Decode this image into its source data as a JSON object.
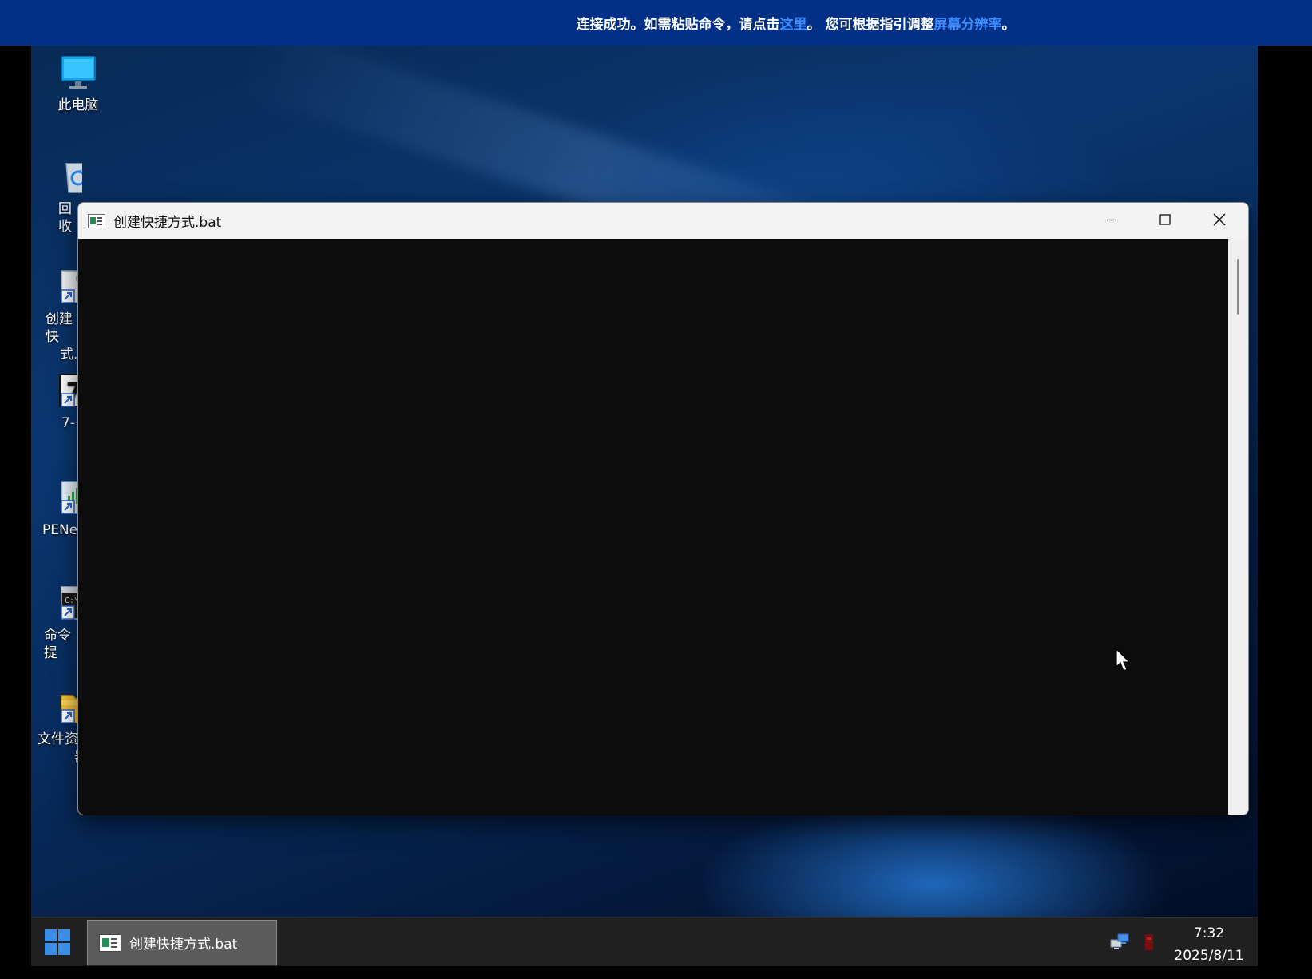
{
  "banner": {
    "text_before": "连接成功。如需粘贴命令，请点击",
    "link_here": "这里",
    "text_middle": "。 您可根据指引调整",
    "link_resolution": "屏幕分辨率",
    "text_after": "。"
  },
  "desktop_icons": [
    {
      "label": "此电脑",
      "icon": "computer-icon"
    },
    {
      "label": "回收",
      "icon": "recycle-bin-icon"
    },
    {
      "label": "创建快",
      "label2": "式.",
      "icon": "bat-shortcut-icon"
    },
    {
      "label": "7-",
      "icon": "7zip-shortcut-icon"
    },
    {
      "label": "PENe",
      "icon": "network-tool-shortcut-icon"
    },
    {
      "label": "命令提",
      "icon": "cmd-shortcut-icon"
    },
    {
      "label": "文件资",
      "label2": "器",
      "icon": "file-explorer-shortcut-icon"
    }
  ],
  "window": {
    "title": "创建快捷方式.bat",
    "icons": [
      "minimize-icon",
      "maximize-icon",
      "close-icon"
    ]
  },
  "taskbar": {
    "task_label": "创建快捷方式.bat",
    "time": "7:32",
    "date": "2025/8/11"
  },
  "colors": {
    "banner_bg": "#023087",
    "banner_link": "#3b8cff",
    "console_bg": "#0c0c0c",
    "taskbar_bg": "#202020"
  }
}
